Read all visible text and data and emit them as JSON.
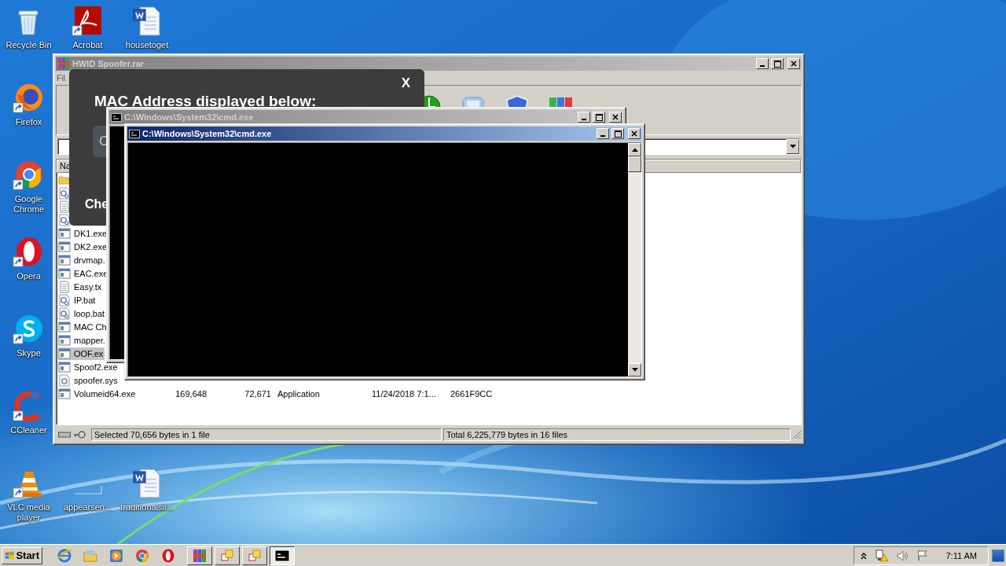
{
  "desktop": {
    "left_column": [
      {
        "label": "Recycle Bin",
        "kind": "recycle",
        "shortcut": false
      },
      {
        "label": "Firefox",
        "kind": "firefox",
        "shortcut": true
      },
      {
        "label": "Google Chrome",
        "kind": "chrome",
        "shortcut": true
      },
      {
        "label": "Opera",
        "kind": "opera",
        "shortcut": true
      },
      {
        "label": "Skype",
        "kind": "skype",
        "shortcut": true
      },
      {
        "label": "CCleaner",
        "kind": "ccleaner",
        "shortcut": true
      },
      {
        "label": "VLC media player",
        "kind": "vlc",
        "shortcut": true
      }
    ],
    "top_row": [
      {
        "label": "Acrobat",
        "kind": "pdf",
        "shortcut": true
      },
      {
        "label": "housetoget",
        "kind": "word",
        "shortcut": false
      }
    ],
    "bottom_row": [
      {
        "label": "appearsen...",
        "kind": "blank",
        "shortcut": false
      },
      {
        "label": "traditionalsil...",
        "kind": "word",
        "shortcut": false
      }
    ]
  },
  "archive_window": {
    "title": "HWID Spoofer.rar",
    "active": false,
    "menu": [
      "Fil"
    ],
    "toolbar": [
      {
        "kind": "globe"
      },
      {
        "kind": "disk"
      },
      {
        "kind": "shield"
      },
      {
        "kind": "blocks"
      }
    ],
    "columns": [
      "Na"
    ],
    "rows": [
      {
        "kind": "folder",
        "selected": false
      },
      {
        "kind": "bat",
        "selected": false
      },
      {
        "kind": "txt",
        "selected": false
      },
      {
        "kind": "bat",
        "selected": false
      },
      {
        "kind": "exe",
        "selected": false,
        "cells": [
          "DK1.exe"
        ]
      },
      {
        "kind": "exe",
        "selected": false,
        "cells": [
          "DK2.exe"
        ]
      },
      {
        "kind": "exe",
        "selected": false,
        "cells": [
          "drvmap."
        ]
      },
      {
        "kind": "exe",
        "selected": false,
        "cells": [
          "EAC.exe"
        ]
      },
      {
        "kind": "txt",
        "selected": false,
        "cells": [
          "Easy.tx"
        ]
      },
      {
        "kind": "bat",
        "selected": false,
        "cells": [
          "IP.bat"
        ]
      },
      {
        "kind": "bat",
        "selected": false,
        "cells": [
          "loop.bat"
        ]
      },
      {
        "kind": "exe",
        "selected": false,
        "cells": [
          "MAC Ch"
        ]
      },
      {
        "kind": "exe",
        "selected": false,
        "cells": [
          "mapper."
        ]
      },
      {
        "kind": "exe",
        "selected": true,
        "cells": [
          "OOF.ex"
        ]
      },
      {
        "kind": "exe",
        "selected": false,
        "cells": [
          "Spoof2.exe"
        ]
      },
      {
        "kind": "sys",
        "selected": false,
        "cells": [
          "spoofer.sys"
        ]
      },
      {
        "kind": "exe",
        "selected": false,
        "cells": [
          "Volumeid64.exe",
          "169,648",
          "72,671",
          "Application",
          "11/24/2018 7:1...",
          "2661F9CC"
        ]
      }
    ],
    "status_left": "Selected 70,656 bytes in 1 file",
    "status_right": "Total 6,225,779 bytes in 16 files"
  },
  "dialog": {
    "close": "X",
    "title": "MAC Address displayed below:",
    "panel_text": "C",
    "footer_text": "Che"
  },
  "cmd_windows": [
    {
      "title": "C:\\Windows\\System32\\cmd.exe",
      "active": false
    },
    {
      "title": "C:\\Windows\\System32\\cmd.exe",
      "active": true
    }
  ],
  "taskbar": {
    "start": "Start",
    "quick_launch": [
      {
        "kind": "ie"
      },
      {
        "kind": "explorer"
      },
      {
        "kind": "media"
      },
      {
        "kind": "chrome"
      },
      {
        "kind": "opera"
      }
    ],
    "tasks": [
      {
        "kind": "winrar",
        "selected": false
      },
      {
        "kind": "app",
        "selected": false
      },
      {
        "kind": "app",
        "selected": false
      },
      {
        "kind": "cmd",
        "selected": true
      }
    ],
    "clock": "7:11 AM"
  }
}
